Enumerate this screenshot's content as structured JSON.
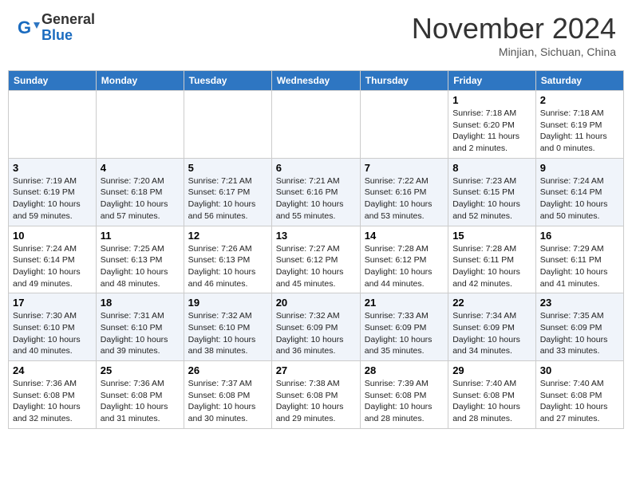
{
  "header": {
    "logo_general": "General",
    "logo_blue": "Blue",
    "month_title": "November 2024",
    "subtitle": "Minjian, Sichuan, China"
  },
  "days_of_week": [
    "Sunday",
    "Monday",
    "Tuesday",
    "Wednesday",
    "Thursday",
    "Friday",
    "Saturday"
  ],
  "weeks": [
    [
      {
        "day": "",
        "info": ""
      },
      {
        "day": "",
        "info": ""
      },
      {
        "day": "",
        "info": ""
      },
      {
        "day": "",
        "info": ""
      },
      {
        "day": "",
        "info": ""
      },
      {
        "day": "1",
        "info": "Sunrise: 7:18 AM\nSunset: 6:20 PM\nDaylight: 11 hours\nand 2 minutes."
      },
      {
        "day": "2",
        "info": "Sunrise: 7:18 AM\nSunset: 6:19 PM\nDaylight: 11 hours\nand 0 minutes."
      }
    ],
    [
      {
        "day": "3",
        "info": "Sunrise: 7:19 AM\nSunset: 6:19 PM\nDaylight: 10 hours\nand 59 minutes."
      },
      {
        "day": "4",
        "info": "Sunrise: 7:20 AM\nSunset: 6:18 PM\nDaylight: 10 hours\nand 57 minutes."
      },
      {
        "day": "5",
        "info": "Sunrise: 7:21 AM\nSunset: 6:17 PM\nDaylight: 10 hours\nand 56 minutes."
      },
      {
        "day": "6",
        "info": "Sunrise: 7:21 AM\nSunset: 6:16 PM\nDaylight: 10 hours\nand 55 minutes."
      },
      {
        "day": "7",
        "info": "Sunrise: 7:22 AM\nSunset: 6:16 PM\nDaylight: 10 hours\nand 53 minutes."
      },
      {
        "day": "8",
        "info": "Sunrise: 7:23 AM\nSunset: 6:15 PM\nDaylight: 10 hours\nand 52 minutes."
      },
      {
        "day": "9",
        "info": "Sunrise: 7:24 AM\nSunset: 6:14 PM\nDaylight: 10 hours\nand 50 minutes."
      }
    ],
    [
      {
        "day": "10",
        "info": "Sunrise: 7:24 AM\nSunset: 6:14 PM\nDaylight: 10 hours\nand 49 minutes."
      },
      {
        "day": "11",
        "info": "Sunrise: 7:25 AM\nSunset: 6:13 PM\nDaylight: 10 hours\nand 48 minutes."
      },
      {
        "day": "12",
        "info": "Sunrise: 7:26 AM\nSunset: 6:13 PM\nDaylight: 10 hours\nand 46 minutes."
      },
      {
        "day": "13",
        "info": "Sunrise: 7:27 AM\nSunset: 6:12 PM\nDaylight: 10 hours\nand 45 minutes."
      },
      {
        "day": "14",
        "info": "Sunrise: 7:28 AM\nSunset: 6:12 PM\nDaylight: 10 hours\nand 44 minutes."
      },
      {
        "day": "15",
        "info": "Sunrise: 7:28 AM\nSunset: 6:11 PM\nDaylight: 10 hours\nand 42 minutes."
      },
      {
        "day": "16",
        "info": "Sunrise: 7:29 AM\nSunset: 6:11 PM\nDaylight: 10 hours\nand 41 minutes."
      }
    ],
    [
      {
        "day": "17",
        "info": "Sunrise: 7:30 AM\nSunset: 6:10 PM\nDaylight: 10 hours\nand 40 minutes."
      },
      {
        "day": "18",
        "info": "Sunrise: 7:31 AM\nSunset: 6:10 PM\nDaylight: 10 hours\nand 39 minutes."
      },
      {
        "day": "19",
        "info": "Sunrise: 7:32 AM\nSunset: 6:10 PM\nDaylight: 10 hours\nand 38 minutes."
      },
      {
        "day": "20",
        "info": "Sunrise: 7:32 AM\nSunset: 6:09 PM\nDaylight: 10 hours\nand 36 minutes."
      },
      {
        "day": "21",
        "info": "Sunrise: 7:33 AM\nSunset: 6:09 PM\nDaylight: 10 hours\nand 35 minutes."
      },
      {
        "day": "22",
        "info": "Sunrise: 7:34 AM\nSunset: 6:09 PM\nDaylight: 10 hours\nand 34 minutes."
      },
      {
        "day": "23",
        "info": "Sunrise: 7:35 AM\nSunset: 6:09 PM\nDaylight: 10 hours\nand 33 minutes."
      }
    ],
    [
      {
        "day": "24",
        "info": "Sunrise: 7:36 AM\nSunset: 6:08 PM\nDaylight: 10 hours\nand 32 minutes."
      },
      {
        "day": "25",
        "info": "Sunrise: 7:36 AM\nSunset: 6:08 PM\nDaylight: 10 hours\nand 31 minutes."
      },
      {
        "day": "26",
        "info": "Sunrise: 7:37 AM\nSunset: 6:08 PM\nDaylight: 10 hours\nand 30 minutes."
      },
      {
        "day": "27",
        "info": "Sunrise: 7:38 AM\nSunset: 6:08 PM\nDaylight: 10 hours\nand 29 minutes."
      },
      {
        "day": "28",
        "info": "Sunrise: 7:39 AM\nSunset: 6:08 PM\nDaylight: 10 hours\nand 28 minutes."
      },
      {
        "day": "29",
        "info": "Sunrise: 7:40 AM\nSunset: 6:08 PM\nDaylight: 10 hours\nand 28 minutes."
      },
      {
        "day": "30",
        "info": "Sunrise: 7:40 AM\nSunset: 6:08 PM\nDaylight: 10 hours\nand 27 minutes."
      }
    ]
  ]
}
